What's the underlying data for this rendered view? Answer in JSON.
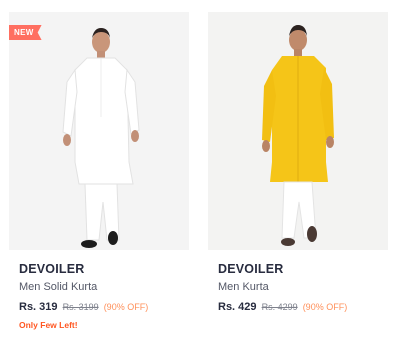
{
  "products": [
    {
      "badge": "NEW",
      "image": "man-in-white-kurta-pajama",
      "kurta_color": "#ffffff",
      "brand": "DEVOILER",
      "name": "Men Solid Kurta",
      "price": "Rs. 319",
      "mrp": "Rs. 3199",
      "discount": "(90% OFF)",
      "stock_note": "Only Few Left!"
    },
    {
      "image": "man-in-yellow-kurta-white-pajama",
      "kurta_color": "#f5c518",
      "brand": "DEVOILER",
      "name": "Men Kurta",
      "price": "Rs. 429",
      "mrp": "Rs. 4299",
      "discount": "(90% OFF)"
    }
  ],
  "colors": {
    "badge": "#ff6f61",
    "discount": "#ff905a",
    "stock_note": "#ff5722",
    "brand_text": "#282c3f"
  }
}
